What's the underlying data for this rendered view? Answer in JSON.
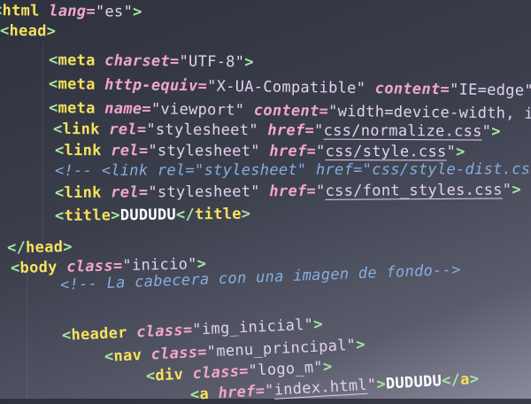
{
  "colors": {
    "tag": "#f6e25e",
    "bracket": "#a8e6a2",
    "attribute": "#f2a6cc",
    "string": "#e2d2ee",
    "comment": "#86aee0",
    "text": "#ffffff",
    "background": "#363a46"
  },
  "code_lines": [
    [
      [
        "br",
        "<"
      ],
      [
        "tag",
        "html"
      ],
      [
        "sp",
        " "
      ],
      [
        "attr",
        "lang"
      ],
      [
        "eq",
        "="
      ],
      [
        "str",
        "\"es\""
      ],
      [
        "br",
        ">"
      ]
    ],
    [
      [
        "br",
        "<"
      ],
      [
        "tag",
        "head"
      ],
      [
        "br",
        ">"
      ]
    ],
    [
      [
        "br",
        "<"
      ],
      [
        "tag",
        "meta"
      ],
      [
        "sp",
        " "
      ],
      [
        "attr",
        "charset"
      ],
      [
        "eq",
        "="
      ],
      [
        "str",
        "\"UTF-8\""
      ],
      [
        "br",
        ">"
      ]
    ],
    [
      [
        "br",
        "<"
      ],
      [
        "tag",
        "meta"
      ],
      [
        "sp",
        " "
      ],
      [
        "attr",
        "http-equiv"
      ],
      [
        "eq",
        "="
      ],
      [
        "str",
        "\"X-UA-Compatible\""
      ],
      [
        "sp",
        " "
      ],
      [
        "attr",
        "content"
      ],
      [
        "eq",
        "="
      ],
      [
        "str",
        "\"IE=edge\""
      ]
    ],
    [
      [
        "br",
        "<"
      ],
      [
        "tag",
        "meta"
      ],
      [
        "sp",
        " "
      ],
      [
        "attr",
        "name"
      ],
      [
        "eq",
        "="
      ],
      [
        "str",
        "\"viewport\""
      ],
      [
        "sp",
        " "
      ],
      [
        "attr",
        "content"
      ],
      [
        "eq",
        "="
      ],
      [
        "str",
        "\"width=device-width, i"
      ]
    ],
    [
      [
        "br",
        "<"
      ],
      [
        "tag",
        "link"
      ],
      [
        "sp",
        " "
      ],
      [
        "attr",
        "rel"
      ],
      [
        "eq",
        "="
      ],
      [
        "str",
        "\"stylesheet\""
      ],
      [
        "sp",
        " "
      ],
      [
        "attr",
        "href"
      ],
      [
        "eq",
        "="
      ],
      [
        "str",
        "\""
      ],
      [
        "link",
        "css/normalize.css"
      ],
      [
        "str",
        "\""
      ],
      [
        "br",
        ">"
      ]
    ],
    [
      [
        "br",
        "<"
      ],
      [
        "tag",
        "link"
      ],
      [
        "sp",
        " "
      ],
      [
        "attr",
        "rel"
      ],
      [
        "eq",
        "="
      ],
      [
        "str",
        "\"stylesheet\""
      ],
      [
        "sp",
        " "
      ],
      [
        "attr",
        "href"
      ],
      [
        "eq",
        "="
      ],
      [
        "str",
        "\""
      ],
      [
        "link",
        "css/style.css"
      ],
      [
        "str",
        "\""
      ],
      [
        "br",
        ">"
      ]
    ],
    [
      [
        "com",
        "<!-- <link rel=\"stylesheet\" href=\"css/style-dist.css"
      ]
    ],
    [
      [
        "br",
        "<"
      ],
      [
        "tag",
        "link"
      ],
      [
        "sp",
        " "
      ],
      [
        "attr",
        "rel"
      ],
      [
        "eq",
        "="
      ],
      [
        "str",
        "\"stylesheet\""
      ],
      [
        "sp",
        " "
      ],
      [
        "attr",
        "href"
      ],
      [
        "eq",
        "="
      ],
      [
        "str",
        "\""
      ],
      [
        "link",
        "css/font_styles.css"
      ],
      [
        "str",
        "\""
      ],
      [
        "br",
        ">"
      ]
    ],
    [
      [
        "br",
        "<"
      ],
      [
        "tag",
        "title"
      ],
      [
        "br",
        ">"
      ],
      [
        "text",
        "DUDUDU"
      ],
      [
        "br",
        "</"
      ],
      [
        "tag",
        "title"
      ],
      [
        "br",
        ">"
      ]
    ],
    [
      [
        "br",
        "</"
      ],
      [
        "tag",
        "head"
      ],
      [
        "br",
        ">"
      ]
    ],
    [
      [
        "br",
        "<"
      ],
      [
        "tag",
        "body"
      ],
      [
        "sp",
        " "
      ],
      [
        "attr",
        "class"
      ],
      [
        "eq",
        "="
      ],
      [
        "str",
        "\"inicio\""
      ],
      [
        "br",
        ">"
      ]
    ],
    [
      [
        "com",
        "<!-- La cabecera con una imagen de fondo-->"
      ]
    ],
    [
      [
        "br",
        "<"
      ],
      [
        "tag",
        "header"
      ],
      [
        "sp",
        " "
      ],
      [
        "attr",
        "class"
      ],
      [
        "eq",
        "="
      ],
      [
        "str",
        "\"img_inicial\""
      ],
      [
        "br",
        ">"
      ]
    ],
    [
      [
        "br",
        "<"
      ],
      [
        "tag",
        "nav"
      ],
      [
        "sp",
        " "
      ],
      [
        "attr",
        "class"
      ],
      [
        "eq",
        "="
      ],
      [
        "str",
        "\"menu_principal\""
      ],
      [
        "br",
        ">"
      ]
    ],
    [
      [
        "br",
        "<"
      ],
      [
        "tag",
        "div"
      ],
      [
        "sp",
        " "
      ],
      [
        "attr",
        "class"
      ],
      [
        "eq",
        "="
      ],
      [
        "str",
        "\"logo_m\""
      ],
      [
        "br",
        ">"
      ]
    ],
    [
      [
        "br",
        "<"
      ],
      [
        "tag",
        "a"
      ],
      [
        "sp",
        " "
      ],
      [
        "attr",
        "href"
      ],
      [
        "eq",
        "="
      ],
      [
        "str",
        "\""
      ],
      [
        "link",
        "index.html"
      ],
      [
        "str",
        "\""
      ],
      [
        "br",
        ">"
      ],
      [
        "text",
        "DUDUDU"
      ],
      [
        "br",
        "</"
      ],
      [
        "tag",
        "a"
      ],
      [
        "br",
        ">"
      ]
    ]
  ]
}
